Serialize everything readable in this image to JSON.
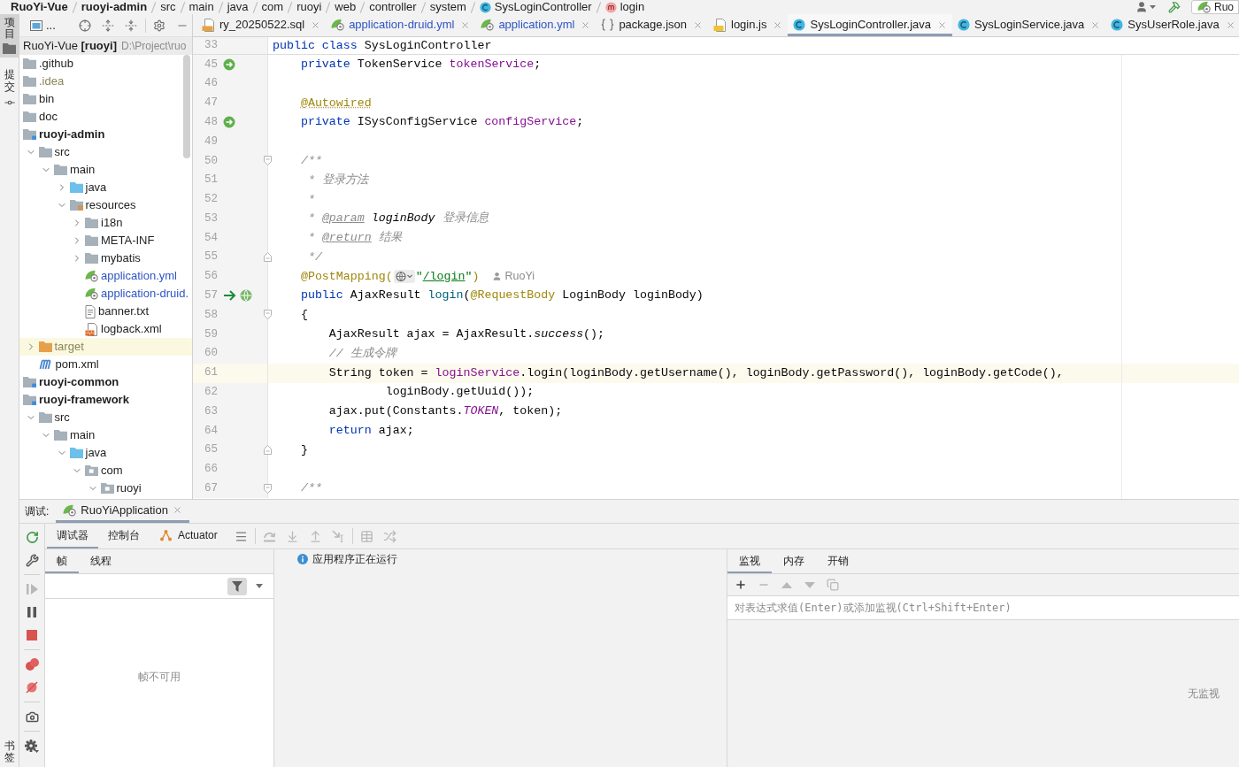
{
  "breadcrumb": {
    "items": [
      {
        "text": "RuoYi-Vue",
        "kind": "project"
      },
      {
        "text": "ruoyi-admin",
        "kind": "module"
      },
      {
        "text": "src",
        "kind": "folder"
      },
      {
        "text": "main",
        "kind": "folder"
      },
      {
        "text": "java",
        "kind": "folder"
      },
      {
        "text": "com",
        "kind": "folder"
      },
      {
        "text": "ruoyi",
        "kind": "folder"
      },
      {
        "text": "web",
        "kind": "folder"
      },
      {
        "text": "controller",
        "kind": "folder"
      },
      {
        "text": "system",
        "kind": "folder"
      },
      {
        "text": "SysLoginController",
        "kind": "class"
      },
      {
        "text": "login",
        "kind": "method"
      }
    ],
    "run_config": "Ruo"
  },
  "tool_stripe": {
    "top": [
      {
        "label": "项目",
        "kind": "project",
        "selected": true
      },
      {
        "label": "提交",
        "kind": "commit",
        "selected": false
      }
    ],
    "bottom": [
      {
        "label": "书签",
        "selected": false
      }
    ]
  },
  "project": {
    "title": "...",
    "root": {
      "name": "RuoYi-Vue",
      "qualifier": "[ruoyi]",
      "path": "D:\\Project\\ruo"
    },
    "items": [
      {
        "name": ".github",
        "kind": "folder",
        "modified": false,
        "ignored": false
      },
      {
        "name": ".idea",
        "kind": "folder",
        "modified": false,
        "ignored": true
      },
      {
        "name": "bin",
        "kind": "folder",
        "modified": false,
        "ignored": false
      },
      {
        "name": "doc",
        "kind": "folder",
        "modified": false,
        "ignored": false
      },
      {
        "name": "ruoyi-admin",
        "kind": "module",
        "modified": false,
        "ignored": false,
        "children": [
          {
            "name": "src",
            "kind": "folder",
            "modified": false,
            "ignored": false,
            "expanded": true,
            "children": [
              {
                "name": "main",
                "kind": "folder",
                "modified": false,
                "ignored": false,
                "expanded": true,
                "children": [
                  {
                    "name": "java",
                    "kind": "source_folder",
                    "modified": false,
                    "ignored": false,
                    "expanded": false
                  },
                  {
                    "name": "resources",
                    "kind": "resources_folder",
                    "modified": false,
                    "ignored": false,
                    "expanded": true,
                    "children": [
                      {
                        "name": "i18n",
                        "kind": "folder",
                        "modified": false,
                        "ignored": false,
                        "expanded": false
                      },
                      {
                        "name": "META-INF",
                        "kind": "folder",
                        "modified": false,
                        "ignored": false,
                        "expanded": false
                      },
                      {
                        "name": "mybatis",
                        "kind": "folder",
                        "modified": false,
                        "ignored": false,
                        "expanded": false
                      },
                      {
                        "name": "application.yml",
                        "kind": "spring_config",
                        "modified": true,
                        "ignored": false
                      },
                      {
                        "name": "application-druid.",
                        "kind": "spring_config",
                        "modified": true,
                        "ignored": false
                      },
                      {
                        "name": "banner.txt",
                        "kind": "text_file",
                        "modified": false,
                        "ignored": false
                      },
                      {
                        "name": "logback.xml",
                        "kind": "log_config",
                        "modified": false,
                        "ignored": false
                      }
                    ]
                  }
                ]
              }
            ]
          },
          {
            "name": "target",
            "kind": "excluded_folder",
            "modified": false,
            "ignored": true,
            "expanded": false
          },
          {
            "name": "pom.xml",
            "kind": "maven",
            "modified": false,
            "ignored": false
          }
        ]
      },
      {
        "name": "ruoyi-common",
        "kind": "module",
        "modified": false,
        "ignored": false
      },
      {
        "name": "ruoyi-framework",
        "kind": "module",
        "modified": false,
        "ignored": false,
        "children": [
          {
            "name": "src",
            "kind": "folder",
            "modified": false,
            "ignored": false,
            "expanded": true,
            "children": [
              {
                "name": "main",
                "kind": "folder",
                "modified": false,
                "ignored": false,
                "expanded": true,
                "children": [
                  {
                    "name": "java",
                    "kind": "source_folder",
                    "modified": false,
                    "ignored": false,
                    "expanded": true,
                    "children": [
                      {
                        "name": "com",
                        "kind": "package",
                        "modified": false,
                        "ignored": false,
                        "expanded": true,
                        "children": [
                          {
                            "name": "ruoyi",
                            "kind": "package",
                            "modified": false,
                            "ignored": false,
                            "expanded": true
                          }
                        ]
                      }
                    ]
                  }
                ]
              }
            ]
          }
        ]
      }
    ]
  },
  "editor": {
    "tabs": [
      {
        "name": "ry_20250522.sql",
        "kind": "sql",
        "modified": false,
        "selected": false
      },
      {
        "name": "application-druid.yml",
        "kind": "spring_config",
        "modified": true,
        "selected": false
      },
      {
        "name": "application.yml",
        "kind": "spring_config",
        "modified": true,
        "selected": false
      },
      {
        "name": "package.json",
        "kind": "json",
        "modified": false,
        "selected": false
      },
      {
        "name": "login.js",
        "kind": "js",
        "modified": false,
        "selected": false
      },
      {
        "name": "SysLoginController.java",
        "kind": "class",
        "modified": false,
        "selected": true
      },
      {
        "name": "SysLoginService.java",
        "kind": "class",
        "modified": false,
        "selected": false
      },
      {
        "name": "SysUserRole.java",
        "kind": "class",
        "modified": false,
        "selected": false
      }
    ],
    "sticky": {
      "number": "33",
      "tokens": [
        {
          "kind": "keyword",
          "text": "public class"
        },
        {
          "kind": "plain",
          "text": " SysLoginController"
        }
      ]
    },
    "lines": [
      {
        "number": "45",
        "current": false,
        "gutter": [
          {
            "kind": "bean"
          }
        ],
        "tokens": [
          {
            "kind": "keyword",
            "text": "    private"
          },
          {
            "kind": "plain",
            "text": " TokenService "
          },
          {
            "kind": "field",
            "text": "tokenService"
          },
          {
            "kind": "plain",
            "text": ";"
          }
        ]
      },
      {
        "number": "46",
        "current": false
      },
      {
        "number": "47",
        "current": false,
        "tokens": [
          {
            "kind": "annotation_warning",
            "text": "    @Autowired"
          }
        ]
      },
      {
        "number": "48",
        "current": false,
        "gutter": [
          {
            "kind": "bean"
          }
        ],
        "tokens": [
          {
            "kind": "keyword",
            "text": "    private"
          },
          {
            "kind": "plain",
            "text": " ISysConfigService "
          },
          {
            "kind": "field",
            "text": "configService"
          },
          {
            "kind": "plain",
            "text": ";"
          }
        ]
      },
      {
        "number": "49",
        "current": false
      },
      {
        "number": "50",
        "current": false,
        "fold": {
          "kind": "start"
        },
        "tokens": [
          {
            "kind": "doc",
            "text": "    /**"
          }
        ]
      },
      {
        "number": "51",
        "current": false,
        "tokens": [
          {
            "kind": "doc",
            "text": "     * 登录方法"
          }
        ]
      },
      {
        "number": "52",
        "current": false,
        "tokens": [
          {
            "kind": "doc",
            "text": "     *"
          }
        ]
      },
      {
        "number": "53",
        "current": false,
        "tokens": [
          {
            "kind": "doc",
            "text": "     * "
          },
          {
            "kind": "doc_tag",
            "text": "@param"
          },
          {
            "kind": "doc_param",
            "text": " loginBody"
          },
          {
            "kind": "doc",
            "text": " 登录信息"
          }
        ]
      },
      {
        "number": "54",
        "current": false,
        "tokens": [
          {
            "kind": "doc",
            "text": "     * "
          },
          {
            "kind": "doc_tag",
            "text": "@return"
          },
          {
            "kind": "doc",
            "text": " 结果"
          }
        ]
      },
      {
        "number": "55",
        "current": false,
        "fold": {
          "kind": "end"
        },
        "tokens": [
          {
            "kind": "doc",
            "text": "     */"
          }
        ]
      },
      {
        "number": "56",
        "current": false,
        "tokens": [
          {
            "kind": "annotation",
            "text": "    @PostMapping("
          },
          {
            "kind": "url_inlay"
          },
          {
            "kind": "string",
            "text": "\""
          },
          {
            "kind": "string_link",
            "text": "/login"
          },
          {
            "kind": "string",
            "text": "\""
          },
          {
            "kind": "annotation",
            "text": ")"
          },
          {
            "kind": "author_hint",
            "text": "RuoYi"
          }
        ]
      },
      {
        "number": "57",
        "current": false,
        "gutter": [
          {
            "kind": "execution_point"
          },
          {
            "kind": "web_endpoint"
          }
        ],
        "tokens": [
          {
            "kind": "keyword",
            "text": "    public"
          },
          {
            "kind": "plain",
            "text": " AjaxResult "
          },
          {
            "kind": "method_decl",
            "text": "login"
          },
          {
            "kind": "plain",
            "text": "("
          },
          {
            "kind": "annotation",
            "text": "@RequestBody"
          },
          {
            "kind": "plain",
            "text": " LoginBody loginBody)"
          }
        ]
      },
      {
        "number": "58",
        "current": false,
        "fold": {
          "kind": "start"
        },
        "tokens": [
          {
            "kind": "plain",
            "text": "    {"
          }
        ]
      },
      {
        "number": "59",
        "current": false,
        "tokens": [
          {
            "kind": "plain",
            "text": "        AjaxResult ajax = AjaxResult."
          },
          {
            "kind": "static_call",
            "text": "success"
          },
          {
            "kind": "plain",
            "text": "();"
          }
        ]
      },
      {
        "number": "60",
        "current": false,
        "tokens": [
          {
            "kind": "comment",
            "text": "        // 生成令牌"
          }
        ]
      },
      {
        "number": "61",
        "current": true,
        "tokens": [
          {
            "kind": "plain",
            "text": "        String token = "
          },
          {
            "kind": "field",
            "text": "loginService"
          },
          {
            "kind": "plain",
            "text": ".login(loginBody.getUsername(), loginBody.getPassword(), loginBody.getCode(),"
          }
        ]
      },
      {
        "number": "62",
        "current": false,
        "tokens": [
          {
            "kind": "plain",
            "text": "                loginBody.getUuid());"
          }
        ]
      },
      {
        "number": "63",
        "current": false,
        "tokens": [
          {
            "kind": "plain",
            "text": "        ajax.put(Constants."
          },
          {
            "kind": "static_field",
            "text": "TOKEN"
          },
          {
            "kind": "plain",
            "text": ", token);"
          }
        ]
      },
      {
        "number": "64",
        "current": false,
        "tokens": [
          {
            "kind": "keyword",
            "text": "        return"
          },
          {
            "kind": "plain",
            "text": " ajax;"
          }
        ]
      },
      {
        "number": "65",
        "current": false,
        "fold": {
          "kind": "end"
        },
        "tokens": [
          {
            "kind": "plain",
            "text": "    }"
          }
        ]
      },
      {
        "number": "66",
        "current": false
      },
      {
        "number": "67",
        "current": false,
        "fold": {
          "kind": "start"
        },
        "tokens": [
          {
            "kind": "doc",
            "text": "    /**"
          }
        ]
      }
    ]
  },
  "debug": {
    "title": "调试:",
    "sessions": [
      {
        "name": "RuoYiApplication",
        "selected": true
      }
    ],
    "action_groups": [
      [
        {
          "kind": "rerun",
          "disabled": false
        },
        {
          "kind": "modify_run",
          "disabled": false
        }
      ],
      [
        {
          "kind": "resume",
          "disabled": true
        },
        {
          "kind": "pause",
          "disabled": false
        },
        {
          "kind": "stop",
          "disabled": false
        }
      ],
      [
        {
          "kind": "view_breakpoints",
          "disabled": false
        },
        {
          "kind": "mute_breakpoints",
          "disabled": false
        }
      ],
      [
        {
          "kind": "snapshot",
          "disabled": false
        }
      ],
      [
        {
          "kind": "settings",
          "disabled": false
        }
      ]
    ],
    "tabs": [
      {
        "label": "调试器",
        "kind": "plain",
        "selected": true
      },
      {
        "label": "控制台",
        "kind": "plain",
        "selected": false
      },
      {
        "label": "Actuator",
        "kind": "actuator",
        "selected": false
      }
    ],
    "step_groups": [
      [
        {
          "kind": "layout",
          "disabled": false
        }
      ],
      [
        {
          "kind": "step_over",
          "disabled": true
        },
        {
          "kind": "step_into",
          "disabled": true
        },
        {
          "kind": "step_out",
          "disabled": true
        },
        {
          "kind": "run_to_cursor",
          "disabled": true
        }
      ],
      [
        {
          "kind": "evaluate",
          "disabled": true
        },
        {
          "kind": "trace",
          "disabled": true
        }
      ]
    ],
    "frames": {
      "tabs": [
        {
          "label": "帧",
          "selected": true
        },
        {
          "label": "线程",
          "selected": false
        }
      ],
      "filter_active": true,
      "empty_text": "帧不可用"
    },
    "status": {
      "text": "应用程序正在运行"
    },
    "watches": {
      "tabs": [
        {
          "label": "监视",
          "selected": true
        },
        {
          "label": "内存",
          "selected": false
        },
        {
          "label": "开销",
          "selected": false
        }
      ],
      "actions": [
        {
          "kind": "add",
          "disabled": false
        },
        {
          "kind": "remove",
          "disabled": true
        },
        {
          "kind": "move_up",
          "disabled": true
        },
        {
          "kind": "move_down",
          "disabled": true
        },
        {
          "kind": "duplicate",
          "disabled": true
        }
      ],
      "placeholder": "对表达式求值(Enter)或添加监视(Ctrl+Shift+Enter)",
      "empty_text": "无监视"
    }
  }
}
